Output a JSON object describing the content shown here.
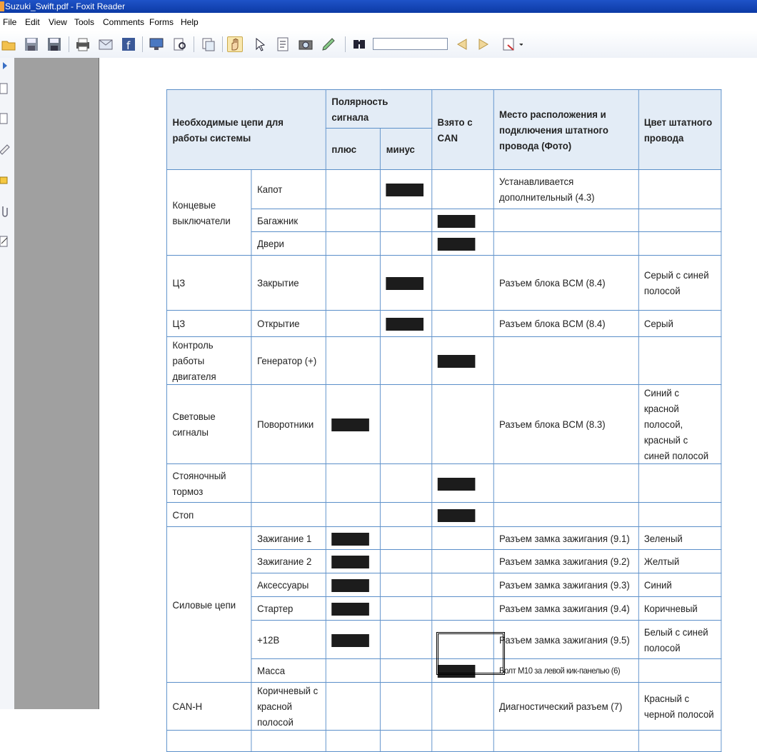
{
  "window": {
    "title": "Suzuki_Swift.pdf - Foxit Reader"
  },
  "menu": [
    "File",
    "Edit",
    "View",
    "Tools",
    "Comments",
    "Forms",
    "Help"
  ],
  "toolbar": {
    "icons": [
      "open-icon",
      "save-icon",
      "save-as-icon",
      "print-icon",
      "email-icon",
      "facebook-icon",
      "monitor-icon",
      "find-pages-icon",
      "pages-icon",
      "hand-tool-icon",
      "select-arrow-icon",
      "text-select-icon",
      "snapshot-icon",
      "annotate-icon",
      "find-icon"
    ],
    "find_value": ""
  },
  "table": {
    "headers": {
      "circuits": "Необходимые цепи для работы системы",
      "polarity": "Полярность сигнала",
      "plus": "плюс",
      "minus": "минус",
      "can": "Взято с CAN",
      "location": "Место расположения и подключения штатного провода (Фото)",
      "color": "Цвет штатного провода"
    },
    "rows": [
      {
        "group": "Концевые выключатели",
        "sub": "Капот",
        "plus": false,
        "minus": true,
        "can": false,
        "location": "Устанавливается дополнительный (4.3)",
        "color": ""
      },
      {
        "group": "",
        "sub": "Багажник",
        "plus": false,
        "minus": false,
        "can": true,
        "location": "",
        "color": ""
      },
      {
        "group": "",
        "sub": "Двери",
        "plus": false,
        "minus": false,
        "can": true,
        "location": "",
        "color": ""
      },
      {
        "group": "ЦЗ",
        "sub": "Закрытие",
        "plus": false,
        "minus": true,
        "can": false,
        "location": "Разъем блока BCM (8.4)",
        "color": "Серый с синей полосой"
      },
      {
        "group": "ЦЗ",
        "sub": "Открытие",
        "plus": false,
        "minus": true,
        "can": false,
        "location": "Разъем блока BCM (8.4)",
        "color": "Серый"
      },
      {
        "group": "Контроль работы двигателя",
        "sub": "Генератор (+)",
        "plus": false,
        "minus": false,
        "can": true,
        "location": "",
        "color": ""
      },
      {
        "group": "Световые сигналы",
        "sub": "Поворотники",
        "plus": true,
        "minus": false,
        "can": false,
        "location": "Разъем блока BCM (8.3)",
        "color": "Синий с красной полосой, красный с синей полосой"
      },
      {
        "group": "Стояночный тормоз",
        "sub": "",
        "plus": false,
        "minus": false,
        "can": true,
        "location": "",
        "color": ""
      },
      {
        "group": "Стоп",
        "sub": "",
        "plus": false,
        "minus": false,
        "can": true,
        "location": "",
        "color": ""
      },
      {
        "group": "Силовые цепи",
        "sub": "Зажигание 1",
        "plus": true,
        "minus": false,
        "can": false,
        "location": "Разъем замка зажигания (9.1)",
        "color": "Зеленый"
      },
      {
        "group": "",
        "sub": "Зажигание 2",
        "plus": true,
        "minus": false,
        "can": false,
        "location": "Разъем замка зажигания (9.2)",
        "color": "Желтый"
      },
      {
        "group": "",
        "sub": "Аксессуары",
        "plus": true,
        "minus": false,
        "can": false,
        "location": "Разъем замка зажигания  (9.3)",
        "color": "Синий"
      },
      {
        "group": "",
        "sub": "Стартер",
        "plus": true,
        "minus": false,
        "can": false,
        "location": "Разъем замка зажигания  (9.4)",
        "color": "Коричневый"
      },
      {
        "group": "",
        "sub": "+12В",
        "plus": true,
        "minus": false,
        "can": false,
        "location": "Разъем замка зажигания  (9.5)",
        "color": "Белый с синей полосой"
      },
      {
        "group": "",
        "sub": "Масса",
        "plus": false,
        "minus": false,
        "can": true,
        "location": "Болт М10 за левой кик-панелью (6)",
        "color": ""
      },
      {
        "group": "CAN-H",
        "sub": "Коричневый с красной полосой",
        "plus": false,
        "minus": false,
        "can": false,
        "location": "Диагностический разъем (7)",
        "color": "Красный с черной полосой"
      }
    ]
  }
}
